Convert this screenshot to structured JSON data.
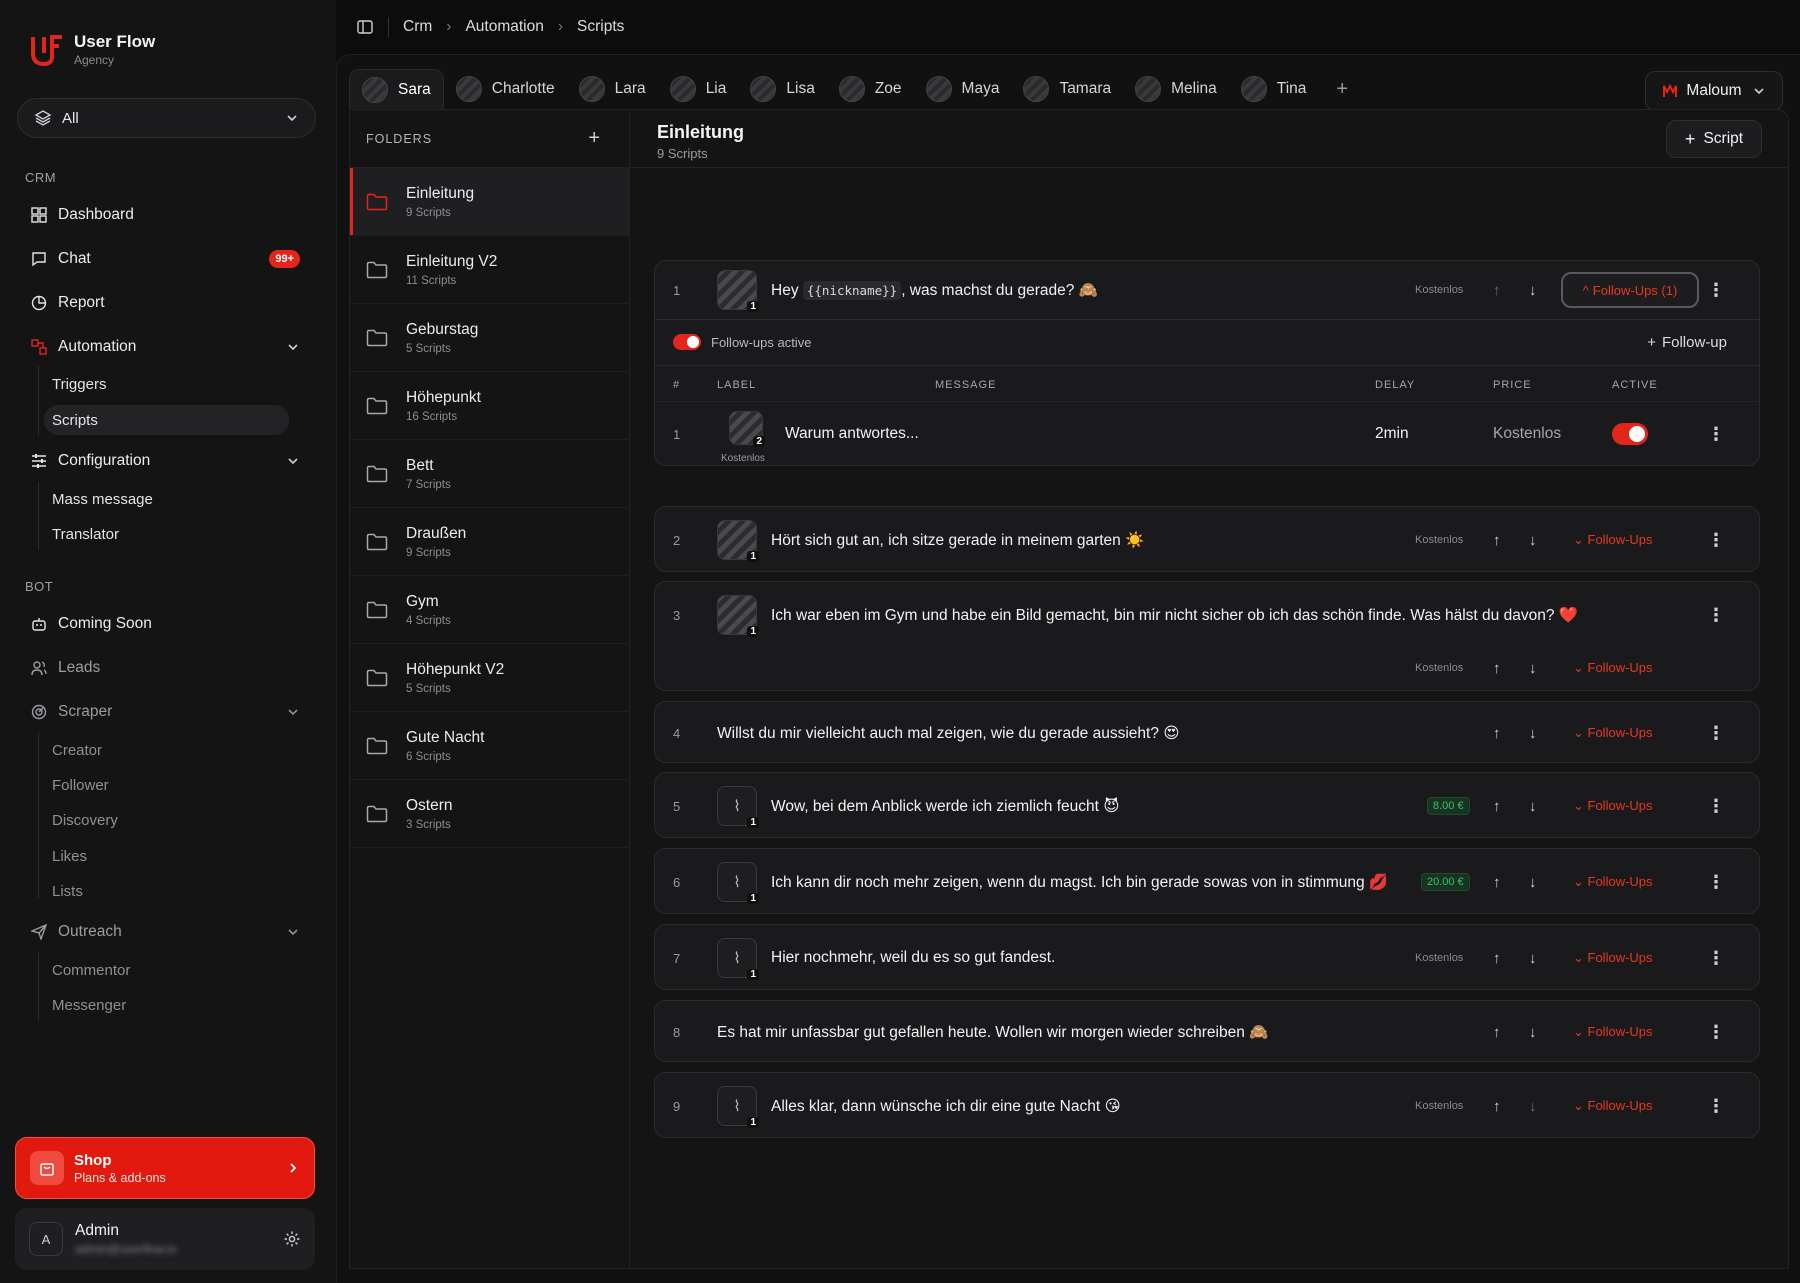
{
  "brand": {
    "name": "User Flow",
    "sub": "Agency"
  },
  "filter": {
    "label": "All"
  },
  "sidebar": {
    "crm_label": "CRM",
    "dashboard": "Dashboard",
    "chat": "Chat",
    "chat_badge": "99+",
    "report": "Report",
    "automation": "Automation",
    "triggers": "Triggers",
    "scripts": "Scripts",
    "configuration": "Configuration",
    "mass_message": "Mass message",
    "translator": "Translator",
    "bot_label": "BOT",
    "coming_soon": "Coming Soon",
    "leads": "Leads",
    "scraper": "Scraper",
    "creator": "Creator",
    "follower": "Follower",
    "discovery": "Discovery",
    "likes": "Likes",
    "lists": "Lists",
    "outreach": "Outreach",
    "commentor": "Commentor",
    "messenger": "Messenger"
  },
  "shop": {
    "title": "Shop",
    "sub": "Plans & add-ons"
  },
  "admin": {
    "initial": "A",
    "name": "Admin",
    "email": "admin@userflow.io"
  },
  "breadcrumb": [
    "Crm",
    "Automation",
    "Scripts"
  ],
  "tabs": [
    "Sara",
    "Charlotte",
    "Lara",
    "Lia",
    "Lisa",
    "Zoe",
    "Maya",
    "Tamara",
    "Melina",
    "Tina"
  ],
  "platform": "Maloum",
  "folders_label": "FOLDERS",
  "folders": [
    {
      "name": "Einleitung",
      "count": "9 Scripts"
    },
    {
      "name": "Einleitung V2",
      "count": "11 Scripts"
    },
    {
      "name": "Geburstag",
      "count": "5 Scripts"
    },
    {
      "name": "Höhepunkt",
      "count": "16 Scripts"
    },
    {
      "name": "Bett",
      "count": "7 Scripts"
    },
    {
      "name": "Draußen",
      "count": "9 Scripts"
    },
    {
      "name": "Gym",
      "count": "4 Scripts"
    },
    {
      "name": "Höhepunkt V2",
      "count": "5 Scripts"
    },
    {
      "name": "Gute Nacht",
      "count": "6 Scripts"
    },
    {
      "name": "Ostern",
      "count": "3 Scripts"
    }
  ],
  "header": {
    "title": "Einleitung",
    "count": "9 Scripts",
    "add_label": "Script"
  },
  "scripts": {
    "s1": {
      "num": "1",
      "pre": "Hey ",
      "code": "{{nickname}}",
      "post": ", was machst du gerade? 🙈",
      "price": "Kostenlos",
      "fu": "Follow-Ups (1)",
      "media": "1"
    },
    "fu_active": "Follow-ups active",
    "add_followup": "Follow-up",
    "cols": {
      "num": "#",
      "label": "LABEL",
      "message": "MESSAGE",
      "delay": "DELAY",
      "price": "PRICE",
      "active": "ACTIVE"
    },
    "followup": {
      "num": "1",
      "label": "Kostenlos",
      "media": "2",
      "message": "Warum antwortes...",
      "delay": "2min",
      "price": "Kostenlos"
    },
    "s2": {
      "num": "2",
      "text": "Hört sich gut an, ich sitze gerade in meinem garten ☀️",
      "price": "Kostenlos",
      "fu": "Follow-Ups",
      "media": "1"
    },
    "s3": {
      "num": "3",
      "text": "Ich war eben im Gym und habe ein Bild gemacht, bin mir nicht sicher ob ich das schön finde. Was hälst du davon? ❤️",
      "price": "Kostenlos",
      "fu": "Follow-Ups",
      "media": "1"
    },
    "s4": {
      "num": "4",
      "text": "Willst du mir vielleicht auch mal zeigen, wie du gerade aussieht? 😍",
      "fu": "Follow-Ups"
    },
    "s5": {
      "num": "5",
      "text": "Wow, bei dem Anblick werde ich ziemlich feucht 😈",
      "price": "8.00 €",
      "fu": "Follow-Ups",
      "media": "1"
    },
    "s6": {
      "num": "6",
      "text": "Ich kann dir noch mehr zeigen, wenn du magst. Ich bin gerade sowas von in stimmung 💋",
      "price": "20.00 €",
      "fu": "Follow-Ups",
      "media": "1"
    },
    "s7": {
      "num": "7",
      "text": "Hier nochmehr, weil du es so gut fandest.",
      "price": "Kostenlos",
      "fu": "Follow-Ups",
      "media": "1"
    },
    "s8": {
      "num": "8",
      "text": "Es hat mir unfassbar gut gefallen heute. Wollen wir morgen wieder schreiben 🙈",
      "fu": "Follow-Ups"
    },
    "s9": {
      "num": "9",
      "text": "Alles klar, dann wünsche ich dir eine gute Nacht 😘",
      "price": "Kostenlos",
      "fu": "Follow-Ups",
      "media": "1"
    }
  },
  "colors": {
    "accent": "#e3261c",
    "paid": "#35c46a"
  }
}
